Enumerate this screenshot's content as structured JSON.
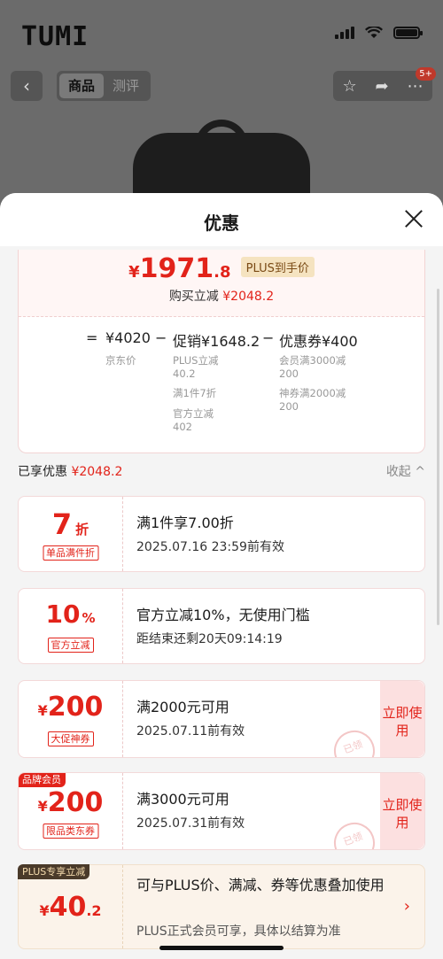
{
  "status_bar": {
    "brand": "TUMI"
  },
  "navbar": {
    "tabs": [
      "商品",
      "测评"
    ],
    "active_tab": 0,
    "cart_badge": "5+"
  },
  "sheet": {
    "title": "优惠",
    "price": {
      "currency": "¥",
      "integer": "1971",
      "decimal": ".8",
      "plus_label": "PLUS到手价",
      "sub_label": "购买立减",
      "sub_amount": "¥2048.2"
    },
    "formula": {
      "eq": "=",
      "base": "¥4020",
      "base_note": "京东价",
      "minus1": "−",
      "promo": "促销¥1648.2",
      "promo_notes": [
        "PLUS立减",
        "40.2",
        "满1件7折",
        "官方立减",
        "402"
      ],
      "minus2": "−",
      "coupon": "优惠券¥400",
      "coupon_notes": [
        "会员满3000减",
        "200",
        "神券满2000减",
        "200"
      ]
    },
    "shared": {
      "label": "已享优惠",
      "amount": "¥2048.2",
      "collapse_label": "收起 ^"
    },
    "coupons": [
      {
        "value_main": "7",
        "value_unit": "折",
        "tag": "单品满件折",
        "title": "满1件享7.00折",
        "desc": "2025.07.16 23:59前有效"
      },
      {
        "value_main": "10",
        "value_unit": "%",
        "tag": "官方立减",
        "title": "官方立减10%，无使用门槛",
        "desc": "距结束还剩20天09:14:19"
      },
      {
        "value_cur": "¥",
        "value_main": "200",
        "tag": "大促神券",
        "title": "满2000元可用",
        "desc": "2025.07.11前有效",
        "action": "立即使用",
        "stamp": "已领"
      },
      {
        "corner": "品牌会员",
        "value_cur": "¥",
        "value_main": "200",
        "tag": "限品类东券",
        "title": "满3000元可用",
        "desc": "2025.07.31前有效",
        "action": "立即使用",
        "stamp": "已领"
      }
    ],
    "plus_card": {
      "corner": "PLUS专享立减",
      "value_cur": "¥",
      "value_main": "40",
      "value_dec": ".2",
      "title": "可与PLUS价、满减、券等优惠叠加使用",
      "desc": "PLUS正式会员可享，具体以结算为准",
      "chevron": "›"
    }
  }
}
